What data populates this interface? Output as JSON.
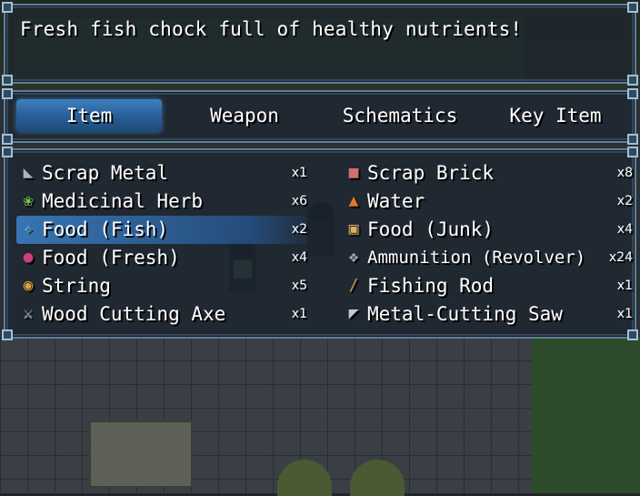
{
  "help": {
    "text": "Fresh fish chock full of healthy nutrients!"
  },
  "categories": [
    {
      "label": "Item",
      "selected": true
    },
    {
      "label": "Weapon",
      "selected": false
    },
    {
      "label": "Schematics",
      "selected": false
    },
    {
      "label": "Key Item",
      "selected": false
    }
  ],
  "items": {
    "left": [
      {
        "name": "Scrap Metal",
        "qty": "x1",
        "icon": "scrap-metal-icon",
        "color": "#a8b4c0"
      },
      {
        "name": "Medicinal Herb",
        "qty": "x6",
        "icon": "herb-icon",
        "color": "#6fbf4a"
      },
      {
        "name": "Food (Fish)",
        "qty": "x2",
        "icon": "fish-icon",
        "color": "#8fc4e8",
        "selected": true
      },
      {
        "name": "Food (Fresh)",
        "qty": "x4",
        "icon": "grapes-icon",
        "color": "#c8407a"
      },
      {
        "name": "String",
        "qty": "x5",
        "icon": "string-icon",
        "color": "#d8a040"
      },
      {
        "name": "Wood Cutting Axe",
        "qty": "x1",
        "icon": "axe-icon",
        "color": "#d0d8e0"
      }
    ],
    "right": [
      {
        "name": "Scrap Brick",
        "qty": "x8",
        "icon": "brick-icon",
        "color": "#d07070"
      },
      {
        "name": "Water",
        "qty": "x2",
        "icon": "bottle-icon",
        "color": "#e07a30"
      },
      {
        "name": "Food (Junk)",
        "qty": "x4",
        "icon": "junk-food-icon",
        "color": "#e0b060"
      },
      {
        "name": "Ammunition (Revolver)",
        "qty": "x24",
        "icon": "revolver-icon",
        "color": "#a0a8c0"
      },
      {
        "name": "Fishing Rod",
        "qty": "x1",
        "icon": "fishing-rod-icon",
        "color": "#c89050"
      },
      {
        "name": "Metal-Cutting Saw",
        "qty": "x1",
        "icon": "saw-icon",
        "color": "#c0c8d8"
      }
    ]
  }
}
